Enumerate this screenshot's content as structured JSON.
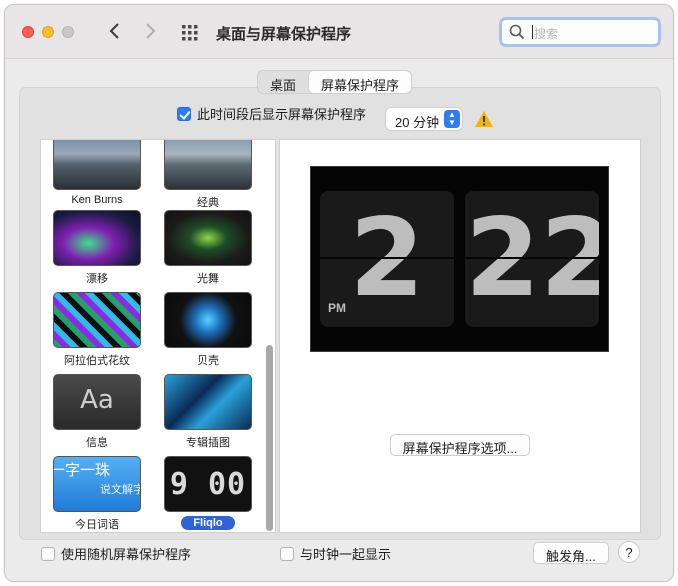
{
  "window": {
    "title": "桌面与屏幕保护程序",
    "search": {
      "placeholder": "搜索"
    }
  },
  "tabs": [
    {
      "label": "桌面",
      "active": false
    },
    {
      "label": "屏幕保护程序",
      "active": true
    }
  ],
  "idle": {
    "checkbox_label": "此时间段后显示屏幕保护程序",
    "checked": true,
    "selected_time": "20 分钟",
    "warning_icon": "warning-icon"
  },
  "screensavers": [
    {
      "name": "Ken Burns"
    },
    {
      "name": "经典"
    },
    {
      "name": "漂移"
    },
    {
      "name": "光舞"
    },
    {
      "name": "阿拉伯式花纹"
    },
    {
      "name": "贝壳"
    },
    {
      "name": "信息"
    },
    {
      "name": "专辑插图"
    },
    {
      "name": "今日词语"
    },
    {
      "name": "Fliqlo",
      "selected": true
    }
  ],
  "thumb_text": {
    "message": "Aa",
    "word_main": "一字一珠",
    "word_sub": "说文解字",
    "fliqlo": "9 00"
  },
  "preview": {
    "hour": "2",
    "minute": "22",
    "ampm": "PM"
  },
  "buttons": {
    "options": "屏幕保护程序选项...",
    "hot_corners": "触发角...",
    "help": "?"
  },
  "bottom": {
    "random_label": "使用随机屏幕保护程序",
    "random_checked": false,
    "clock_label": "与时钟一起显示",
    "clock_checked": false
  },
  "colors": {
    "accent": "#2f7bf5",
    "selection": "#2f63d6",
    "warning": "#f5b400"
  }
}
